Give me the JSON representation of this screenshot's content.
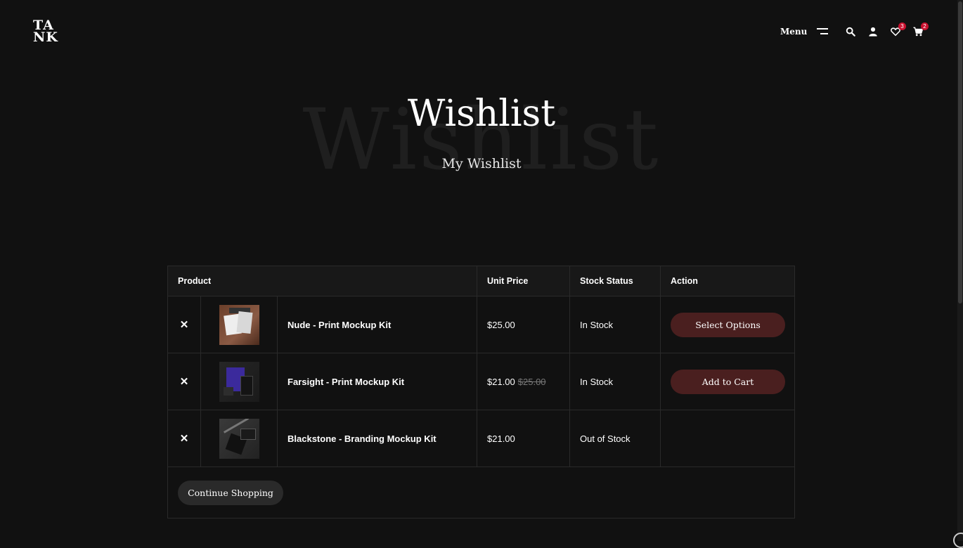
{
  "header": {
    "logo": {
      "line1": "TA",
      "line2": "NK"
    },
    "menu_label": "Menu",
    "wishlist_count": "3",
    "cart_count": "2"
  },
  "hero": {
    "background_text": "Wishlist",
    "title": "Wishlist",
    "subtitle": "My Wishlist"
  },
  "table": {
    "headers": {
      "product": "Product",
      "unit_price": "Unit Price",
      "stock_status": "Stock Status",
      "action": "Action"
    },
    "rows": [
      {
        "remove_icon": "✕",
        "name": "Nude - Print Mockup Kit",
        "price": "$25.00",
        "old_price": "",
        "stock": "In Stock",
        "action": "Select Options"
      },
      {
        "remove_icon": "✕",
        "name": "Farsight - Print Mockup Kit",
        "price": "$21.00",
        "old_price": "$25.00",
        "stock": "In Stock",
        "action": "Add to Cart"
      },
      {
        "remove_icon": "✕",
        "name": "Blackstone - Branding Mockup Kit",
        "price": "$21.00",
        "old_price": "",
        "stock": "Out of Stock",
        "action": ""
      }
    ],
    "continue_label": "Continue Shopping"
  },
  "colors": {
    "background": "#111111",
    "accent_button": "#4a1f1f",
    "badge": "#c8102e"
  },
  "icons": [
    "search-icon",
    "user-icon",
    "heart-icon",
    "cart-icon",
    "hamburger-icon",
    "close-icon"
  ]
}
